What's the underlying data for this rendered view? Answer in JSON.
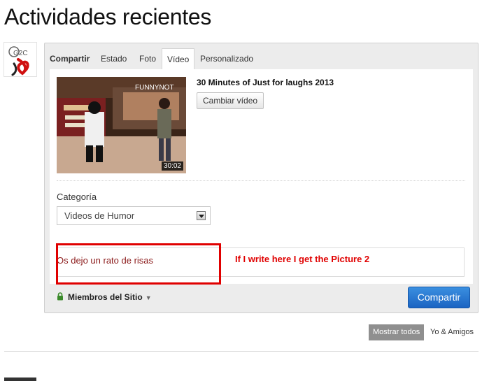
{
  "page": {
    "title": "Actividades recientes"
  },
  "avatar": {
    "logo_text": "G2C"
  },
  "tabs": [
    {
      "label": "Compartir",
      "active": false,
      "bold": true
    },
    {
      "label": "Estado",
      "active": false,
      "bold": false
    },
    {
      "label": "Foto",
      "active": false,
      "bold": false
    },
    {
      "label": "Vídeo",
      "active": true,
      "bold": false
    },
    {
      "label": "Personalizado",
      "active": false,
      "bold": false
    }
  ],
  "video": {
    "title": "30 Minutes of Just for laughs 2013",
    "duration": "30:02",
    "change_label": "Cambiar vídeo",
    "thumb_watermark": "FUNNYNOT"
  },
  "category": {
    "label": "Categoría",
    "selected": "Videos de Humor"
  },
  "message": {
    "text": "Os dejo un rato de risas",
    "annotation": "If I write here I get the Picture 2"
  },
  "privacy": {
    "label": "Miembros del Sitio"
  },
  "share_button": {
    "label": "Compartir"
  },
  "filters": {
    "show_all": "Mostrar todos",
    "me_friends": "Yo & Amigos"
  },
  "colors": {
    "accent": "#1b64c3",
    "annotation": "#e00000",
    "message_text": "#8b1a1a"
  }
}
